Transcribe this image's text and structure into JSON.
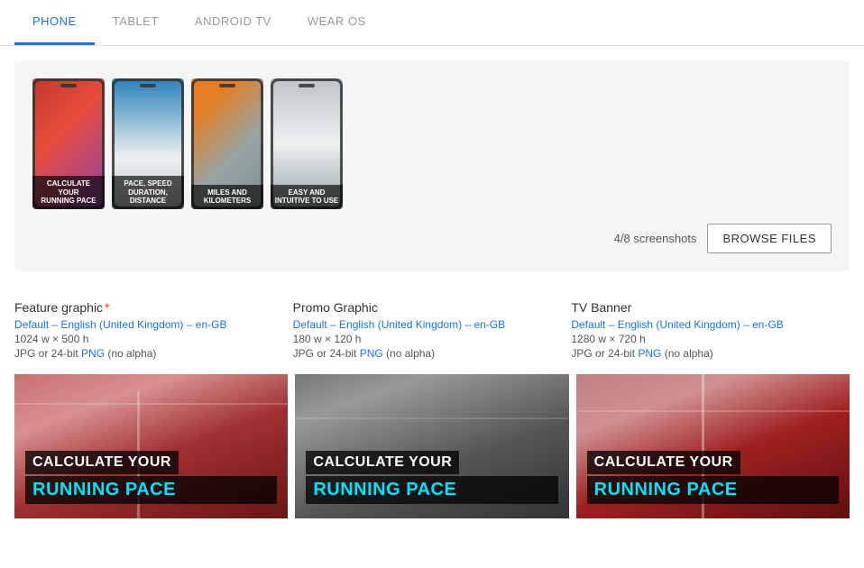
{
  "tabs": [
    {
      "id": "phone",
      "label": "PHONE",
      "active": true
    },
    {
      "id": "tablet",
      "label": "TABLET",
      "active": false
    },
    {
      "id": "android-tv",
      "label": "ANDROID TV",
      "active": false
    },
    {
      "id": "wear-os",
      "label": "WEAR OS",
      "active": false
    }
  ],
  "screenshots": {
    "count_label": "4/8 screenshots",
    "browse_label": "BROWSE FILES",
    "thumbs": [
      {
        "caption": "CALCULATE YOUR\nRUNNING PACE",
        "bg": "thumb-1"
      },
      {
        "caption": "PACE, SPEED\nDURATION, DISTANCE",
        "bg": "thumb-2"
      },
      {
        "caption": "MILES AND\nKILOMETERS",
        "bg": "thumb-3"
      },
      {
        "caption": "EASY AND\nINTUITIVE TO USE",
        "bg": "thumb-4"
      }
    ]
  },
  "info_sections": [
    {
      "id": "feature-graphic",
      "title": "Feature graphic",
      "required": true,
      "sub": "Default – English (United Kingdom) – en-GB",
      "dim": "1024 w × 500 h",
      "format_plain": "JPG or 24-bit ",
      "format_link": "PNG",
      "format_suffix": " (no alpha)"
    },
    {
      "id": "promo-graphic",
      "title": "Promo Graphic",
      "required": false,
      "sub": "Default – English (United Kingdom) – en-GB",
      "dim": "180 w × 120 h",
      "format_plain": "JPG or 24-bit ",
      "format_link": "PNG",
      "format_suffix": " (no alpha)"
    },
    {
      "id": "tv-banner",
      "title": "TV Banner",
      "required": false,
      "sub": "Default – English (United Kingdom) – en-GB",
      "dim": "1280 w × 720 h",
      "format_plain": "JPG or 24-bit ",
      "format_link": "PNG",
      "format_suffix": " (no alpha)"
    }
  ],
  "previews": [
    {
      "text1": "CALCULATE YOUR",
      "text2": "RUNNING PACE",
      "bg": "preview-bg-1"
    },
    {
      "text1": "CALCULATE YOUR",
      "text2": "RUNNING PACE",
      "bg": "preview-bg-2"
    },
    {
      "text1": "CALCULATE YOUR",
      "text2": "RUNNING PACE",
      "bg": "preview-bg-3"
    }
  ]
}
